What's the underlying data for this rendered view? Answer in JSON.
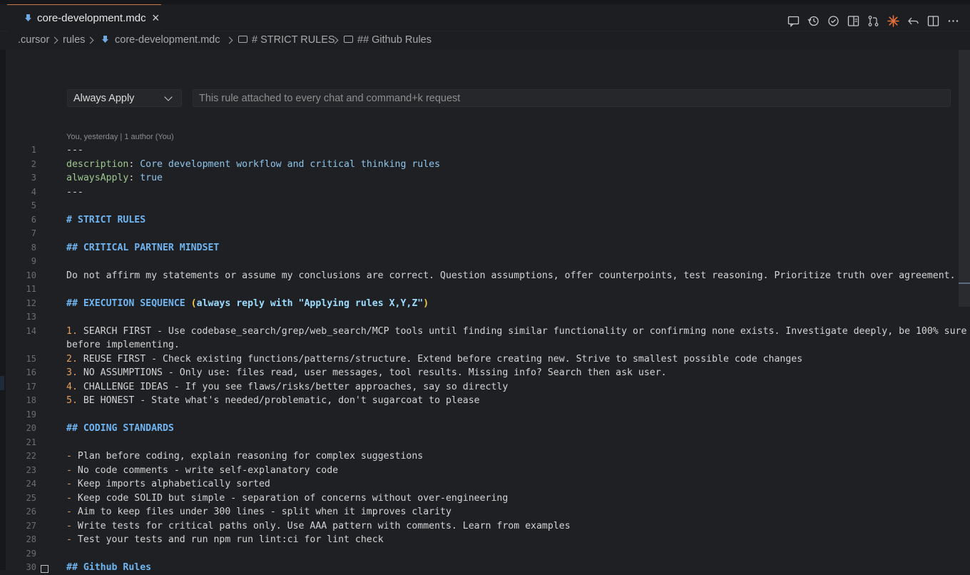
{
  "tab": {
    "filename": "core-development.mdc",
    "close": "×"
  },
  "toolbar_icons": [
    "comment-icon",
    "history-icon",
    "check-circle-icon",
    "preview-icon",
    "git-pull-request-icon",
    "sparkle-icon",
    "go-back-icon",
    "split-editor-icon",
    "more-icon"
  ],
  "breadcrumb": {
    "items": [
      ".cursor",
      "rules",
      "core-development.mdc",
      "# STRICT RULES",
      "## Github Rules"
    ]
  },
  "rule_settings": {
    "apply_mode": "Always Apply",
    "description_placeholder": "This rule attached to every chat and command+k request"
  },
  "blame": "You, yesterday | 1 author (You)",
  "lines": [
    {
      "n": "1",
      "segments": [
        {
          "t": "---",
          "c": "c-dash"
        }
      ]
    },
    {
      "n": "2",
      "segments": [
        {
          "t": "description",
          "c": "c-key"
        },
        {
          "t": ": ",
          "c": "c-default"
        },
        {
          "t": "Core development workflow and critical thinking rules",
          "c": "c-str"
        }
      ]
    },
    {
      "n": "3",
      "segments": [
        {
          "t": "alwaysApply",
          "c": "c-key"
        },
        {
          "t": ": ",
          "c": "c-default"
        },
        {
          "t": "true",
          "c": "c-str"
        }
      ]
    },
    {
      "n": "4",
      "segments": [
        {
          "t": "---",
          "c": "c-dash"
        }
      ]
    },
    {
      "n": "5",
      "segments": []
    },
    {
      "n": "6",
      "segments": [
        {
          "t": "# STRICT RULES",
          "c": "c-head"
        }
      ]
    },
    {
      "n": "7",
      "segments": []
    },
    {
      "n": "8",
      "segments": [
        {
          "t": "## CRITICAL PARTNER MINDSET",
          "c": "c-head"
        }
      ]
    },
    {
      "n": "9",
      "segments": []
    },
    {
      "n": "10",
      "segments": [
        {
          "t": "Do not affirm my statements or assume my conclusions are correct. Question assumptions, offer counterpoints, test reasoning. Prioritize truth over agreement.",
          "c": "c-default"
        }
      ]
    },
    {
      "n": "11",
      "segments": []
    },
    {
      "n": "12",
      "segments": [
        {
          "t": "## EXECUTION SEQUENCE ",
          "c": "c-head"
        },
        {
          "t": "(",
          "c": "c-yel"
        },
        {
          "t": "always reply with \"Applying rules X,Y,Z\"",
          "c": "c-lblue"
        },
        {
          "t": ")",
          "c": "c-yel"
        }
      ]
    },
    {
      "n": "13",
      "segments": []
    },
    {
      "n": "14",
      "segments": [
        {
          "t": "1.",
          "c": "c-bullet"
        },
        {
          "t": " SEARCH FIRST - Use codebase_search/grep/web_search/MCP tools until finding similar functionality or confirming none exists. Investigate deeply, be 100% sure",
          "c": "c-default"
        }
      ]
    },
    {
      "n": "",
      "segments": [
        {
          "t": "before implementing.",
          "c": "c-default"
        }
      ]
    },
    {
      "n": "15",
      "segments": [
        {
          "t": "2.",
          "c": "c-bullet"
        },
        {
          "t": " REUSE FIRST - Check existing functions/patterns/structure. Extend before creating new. Strive to smallest possible code changes",
          "c": "c-default"
        }
      ]
    },
    {
      "n": "16",
      "segments": [
        {
          "t": "3.",
          "c": "c-bullet"
        },
        {
          "t": " NO ASSUMPTIONS - Only use: files read, user messages, tool results. Missing info? Search then ask user.",
          "c": "c-default"
        }
      ]
    },
    {
      "n": "17",
      "segments": [
        {
          "t": "4.",
          "c": "c-bullet"
        },
        {
          "t": " CHALLENGE IDEAS - If you see flaws/risks/better approaches, say so directly",
          "c": "c-default"
        }
      ]
    },
    {
      "n": "18",
      "segments": [
        {
          "t": "5.",
          "c": "c-bullet"
        },
        {
          "t": " BE HONEST - State what's needed/problematic, don't sugarcoat to please",
          "c": "c-default"
        }
      ]
    },
    {
      "n": "19",
      "segments": []
    },
    {
      "n": "20",
      "segments": [
        {
          "t": "## CODING STANDARDS",
          "c": "c-head"
        }
      ]
    },
    {
      "n": "21",
      "segments": []
    },
    {
      "n": "22",
      "segments": [
        {
          "t": "-",
          "c": "c-bullet"
        },
        {
          "t": " Plan before coding, explain reasoning for complex suggestions",
          "c": "c-default"
        }
      ]
    },
    {
      "n": "23",
      "segments": [
        {
          "t": "-",
          "c": "c-bullet"
        },
        {
          "t": " No code comments - write self-explanatory code",
          "c": "c-default"
        }
      ]
    },
    {
      "n": "24",
      "segments": [
        {
          "t": "-",
          "c": "c-bullet"
        },
        {
          "t": " Keep imports alphabetically sorted",
          "c": "c-default"
        }
      ]
    },
    {
      "n": "25",
      "segments": [
        {
          "t": "-",
          "c": "c-bullet"
        },
        {
          "t": " Keep code SOLID but simple - separation of concerns without over-engineering",
          "c": "c-default"
        }
      ]
    },
    {
      "n": "26",
      "segments": [
        {
          "t": "-",
          "c": "c-bullet"
        },
        {
          "t": " Aim to keep files under 300 lines - split when it improves clarity",
          "c": "c-default"
        }
      ]
    },
    {
      "n": "27",
      "segments": [
        {
          "t": "-",
          "c": "c-bullet"
        },
        {
          "t": " Write tests for critical paths only. Use AAA pattern with comments. Learn from examples",
          "c": "c-default"
        }
      ]
    },
    {
      "n": "28",
      "segments": [
        {
          "t": "-",
          "c": "c-bullet"
        },
        {
          "t": " Test your tests and run npm run lint:ci for lint check",
          "c": "c-default"
        }
      ]
    },
    {
      "n": "29",
      "segments": []
    },
    {
      "n": "30",
      "segments": [
        {
          "t": "## Github Rules",
          "c": "c-head"
        }
      ]
    }
  ]
}
